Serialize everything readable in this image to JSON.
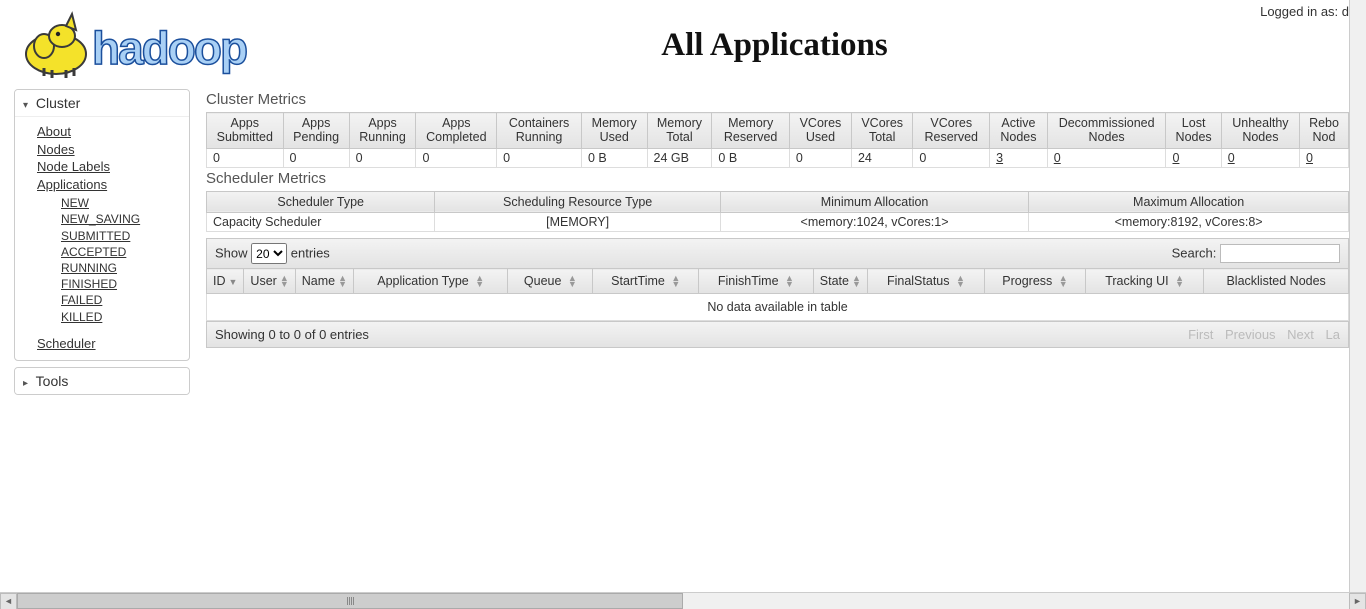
{
  "login": {
    "label": "Logged in as: d"
  },
  "header": {
    "title": "All Applications"
  },
  "sidebar": {
    "cluster": {
      "head": "Cluster",
      "items": [
        {
          "label": "About"
        },
        {
          "label": "Nodes"
        },
        {
          "label": "Node Labels"
        },
        {
          "label": "Applications",
          "sub": [
            {
              "label": "NEW"
            },
            {
              "label": "NEW_SAVING"
            },
            {
              "label": "SUBMITTED"
            },
            {
              "label": "ACCEPTED"
            },
            {
              "label": "RUNNING"
            },
            {
              "label": "FINISHED"
            },
            {
              "label": "FAILED"
            },
            {
              "label": "KILLED"
            }
          ]
        },
        {
          "label": "Scheduler"
        }
      ]
    },
    "tools": {
      "head": "Tools"
    }
  },
  "cluster_metrics": {
    "title": "Cluster Metrics",
    "headers": [
      "Apps Submitted",
      "Apps Pending",
      "Apps Running",
      "Apps Completed",
      "Containers Running",
      "Memory Used",
      "Memory Total",
      "Memory Reserved",
      "VCores Used",
      "VCores Total",
      "VCores Reserved",
      "Active Nodes",
      "Decommissioned Nodes",
      "Lost Nodes",
      "Unhealthy Nodes",
      "Rebo Nod"
    ],
    "values": [
      "0",
      "0",
      "0",
      "0",
      "0",
      "0 B",
      "24 GB",
      "0 B",
      "0",
      "24",
      "0",
      "3",
      "0",
      "0",
      "0",
      "0"
    ]
  },
  "scheduler_metrics": {
    "title": "Scheduler Metrics",
    "headers": [
      "Scheduler Type",
      "Scheduling Resource Type",
      "Minimum Allocation",
      "Maximum Allocation"
    ],
    "values": [
      "Capacity Scheduler",
      "[MEMORY]",
      "<memory:1024, vCores:1>",
      "<memory:8192, vCores:8>"
    ]
  },
  "datatable": {
    "show_prefix": "Show",
    "show_suffix": "entries",
    "page_size": "20",
    "search_label": "Search:",
    "columns": [
      "ID",
      "User",
      "Name",
      "Application Type",
      "Queue",
      "StartTime",
      "FinishTime",
      "State",
      "FinalStatus",
      "Progress",
      "Tracking UI",
      "Blacklisted Nodes"
    ],
    "empty": "No data available in table",
    "info": "Showing 0 to 0 of 0 entries",
    "pager": {
      "first": "First",
      "prev": "Previous",
      "next": "Next",
      "last": "La"
    }
  }
}
